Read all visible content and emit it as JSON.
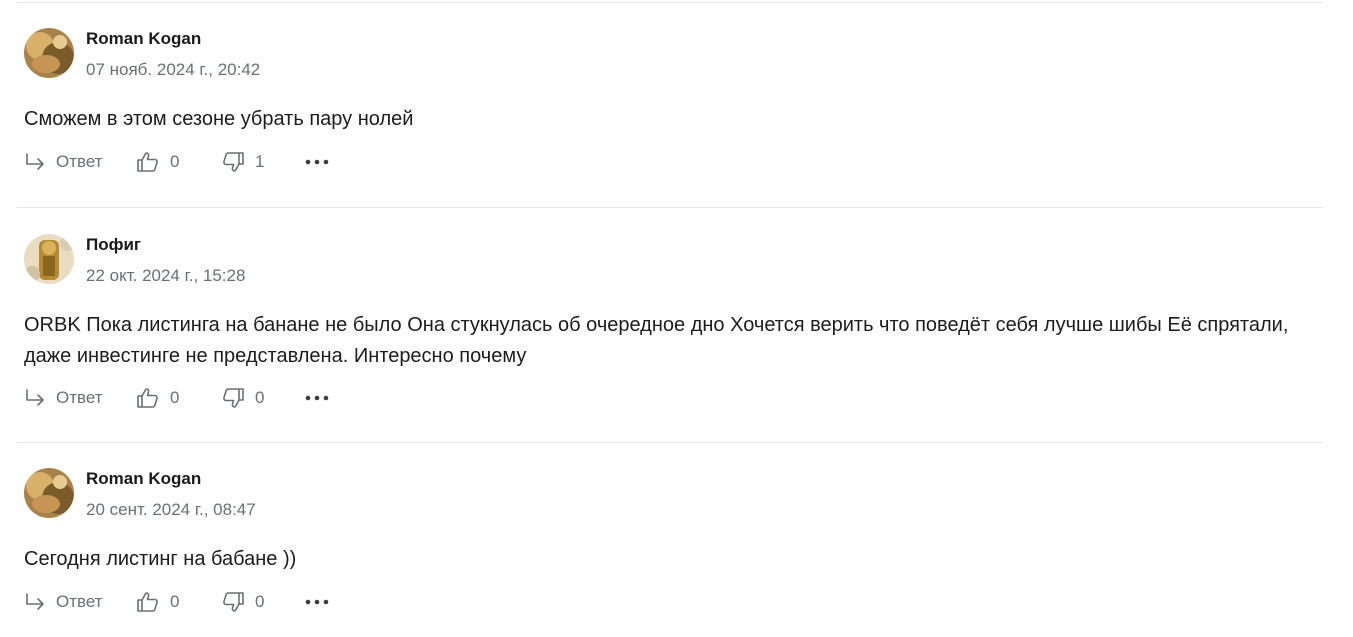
{
  "comments": [
    {
      "author": "Roman Kogan",
      "timestamp": "07 нояб. 2024 г., 20:42",
      "text": "Сможем в этом сезоне убрать пару нолей",
      "reply_label": "Ответ",
      "likes": "0",
      "dislikes": "1"
    },
    {
      "author": "Пофиг",
      "timestamp": "22 окт. 2024 г., 15:28",
      "text": "ORBK Пока листинга на банане не было Она стукнулась об очередное дно Хочется верить что поведёт себя лучше шибы Её спрятали, даже инвестинге не представлена. Интересно почему",
      "reply_label": "Ответ",
      "likes": "0",
      "dislikes": "0"
    },
    {
      "author": "Roman Kogan",
      "timestamp": "20 сент. 2024 г., 08:47",
      "text": "Сегодня листинг на бабане ))",
      "reply_label": "Ответ",
      "likes": "0",
      "dislikes": "0"
    }
  ],
  "icons": {
    "reply": "reply-arrow-icon",
    "like": "thumbs-up-icon",
    "dislike": "thumbs-down-icon",
    "more": "more-dots-icon"
  },
  "colors": {
    "text": "#1c1c1c",
    "muted": "#6b6f76",
    "divider": "#e6e6e6"
  }
}
